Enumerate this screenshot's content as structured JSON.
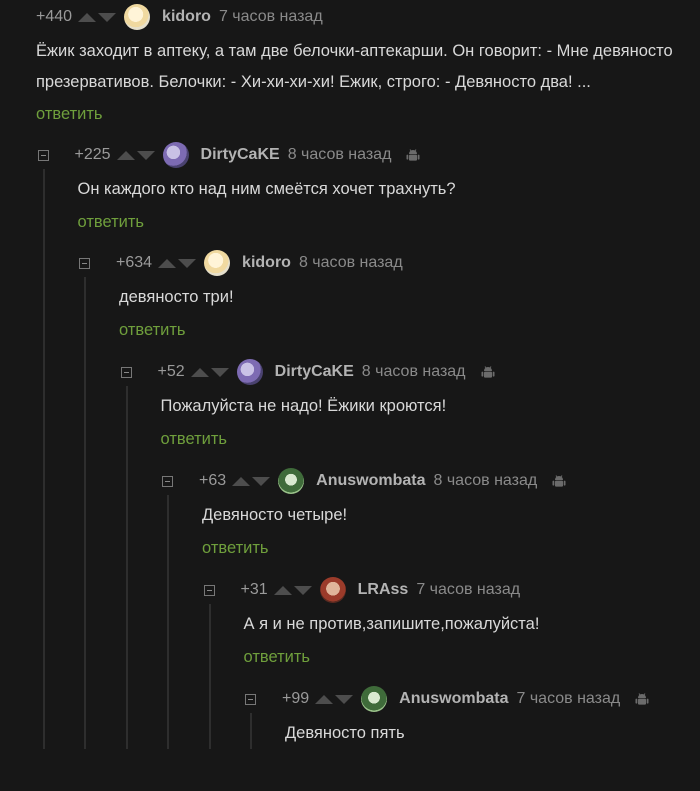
{
  "colors": {
    "background": "#171717",
    "reply_link": "#6f9f3c",
    "author": "#b3b3b3",
    "rating": "#9a9a9a"
  },
  "comments": [
    {
      "rating": "+440",
      "author": "kidoro",
      "time": "7 часов назад",
      "avatar_icon": "avatar-light",
      "text_lines": [
        "Ёжик заходит в аптеку, а там две белочки-аптекарши. Он говорит: - Мне девяносто",
        "презервативов. Белочки: - Хи-хи-хи-хи! Ежик, строго: - Девяносто два! ..."
      ],
      "reply": "ответить",
      "android": false
    },
    {
      "rating": "+225",
      "author": "DirtyCaKE",
      "time": "8 часов назад",
      "avatar_icon": "avatar-purple",
      "text_lines": [
        "Он каждого кто над ним смеётся хочет трахнуть?"
      ],
      "reply": "ответить",
      "android": true
    },
    {
      "rating": "+634",
      "author": "kidoro",
      "time": "8 часов назад",
      "avatar_icon": "avatar-light",
      "text_lines": [
        "девяносто три!"
      ],
      "reply": "ответить",
      "android": false
    },
    {
      "rating": "+52",
      "author": "DirtyCaKE",
      "time": "8 часов назад",
      "avatar_icon": "avatar-purple",
      "text_lines": [
        "Пожалуйста не надо! Ёжики кроются!"
      ],
      "reply": "ответить",
      "android": true
    },
    {
      "rating": "+63",
      "author": "Anuswombata",
      "time": "8 часов назад",
      "avatar_icon": "avatar-green",
      "text_lines": [
        "Девяносто четыре!"
      ],
      "reply": "ответить",
      "android": true
    },
    {
      "rating": "+31",
      "author": "LRAss",
      "time": "7 часов назад",
      "avatar_icon": "avatar-red",
      "text_lines": [
        "А я и не против,запишите,пожалуйста!"
      ],
      "reply": "ответить",
      "android": false
    },
    {
      "rating": "+99",
      "author": "Anuswombata",
      "time": "7 часов назад",
      "avatar_icon": "avatar-green",
      "text_lines": [
        "Девяносто пять"
      ],
      "reply": "",
      "android": true
    }
  ]
}
